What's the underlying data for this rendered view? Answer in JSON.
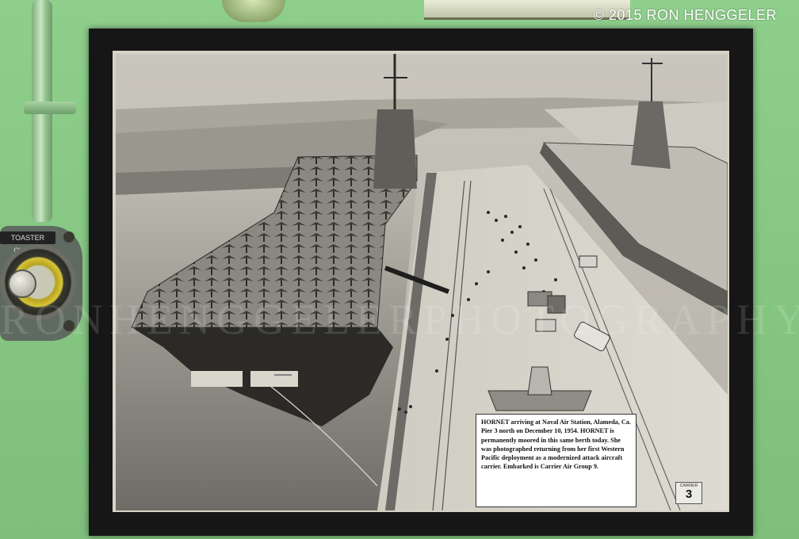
{
  "copyright": "© 2015 RON HENGGELER",
  "watermark": "RONHENGGELERPHOTOGRAPHY.COM",
  "outlet_label": "TOASTER OUTLET",
  "caption": "HORNET arriving at Naval Air Station, Alameda, Ca. Pier 3 north on December 10, 1954. HORNET is permanently moored in this same berth today. She was photographed returning from her first Western Pacific deployment as a modernized attack aircraft carrier. Embarked is Carrier Air Group 9.",
  "pier_sign": {
    "label": "CARRIER",
    "number": "3"
  },
  "ship_name": "HORNET",
  "colors": {
    "wall": "#86c783",
    "frame": "#161616",
    "photo_sepia_light": "#d9d6cc",
    "photo_sepia_dark": "#1c1c1a"
  }
}
